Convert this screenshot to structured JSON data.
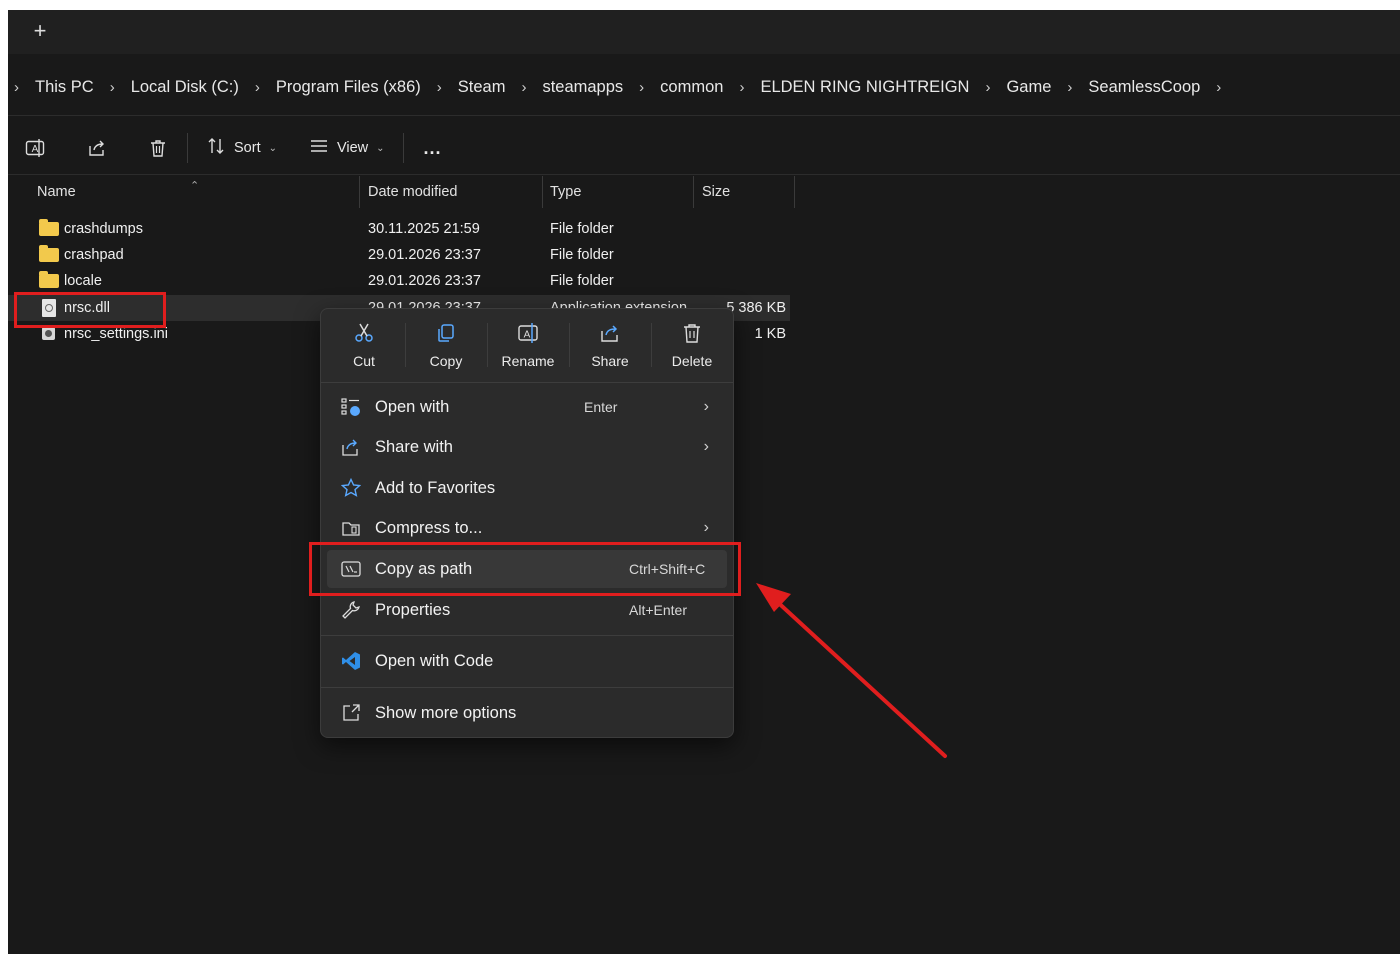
{
  "breadcrumb": [
    "This PC",
    "Local Disk (C:)",
    "Program Files (x86)",
    "Steam",
    "steamapps",
    "common",
    "ELDEN RING NIGHTREIGN",
    "Game",
    "SeamlessCoop"
  ],
  "new_tab_symbol": "+",
  "toolbar": {
    "sort_label": "Sort",
    "view_label": "View",
    "more_label": "..."
  },
  "columns": {
    "name": "Name",
    "date": "Date modified",
    "type": "Type",
    "size": "Size"
  },
  "files": [
    {
      "name": "crashdumps",
      "date": "30.11.2025 21:59",
      "type": "File folder",
      "size": "",
      "icon": "folder-icon"
    },
    {
      "name": "crashpad",
      "date": "29.01.2026 23:37",
      "type": "File folder",
      "size": "",
      "icon": "folder-icon"
    },
    {
      "name": "locale",
      "date": "29.01.2026 23:37",
      "type": "File folder",
      "size": "",
      "icon": "folder-icon"
    },
    {
      "name": "nrsc.dll",
      "date": "29.01.2026 23:37",
      "type": "Application extension",
      "size": "5 386 KB",
      "icon": "dll-file-icon"
    },
    {
      "name": "nrsc_settings.ini",
      "date": "",
      "type": "",
      "size": "1 KB",
      "icon": "ini-file-icon"
    }
  ],
  "context_menu": {
    "quick_actions": [
      "Cut",
      "Copy",
      "Rename",
      "Share",
      "Delete"
    ],
    "items": [
      {
        "label": "Open with",
        "shortcut": "Enter",
        "submenu": true,
        "icon": "open-with-icon"
      },
      {
        "label": "Share with",
        "shortcut": "",
        "submenu": true,
        "icon": "share-icon"
      },
      {
        "label": "Add to Favorites",
        "shortcut": "",
        "submenu": false,
        "icon": "star-icon"
      },
      {
        "label": "Compress to...",
        "shortcut": "",
        "submenu": true,
        "icon": "archive-icon"
      },
      {
        "label": "Copy as path",
        "shortcut": "Ctrl+Shift+C",
        "submenu": false,
        "icon": "copy-path-icon"
      },
      {
        "label": "Properties",
        "shortcut": "Alt+Enter",
        "submenu": false,
        "icon": "wrench-icon"
      },
      {
        "label": "Open with Code",
        "shortcut": "",
        "submenu": false,
        "icon": "vscode-icon"
      },
      {
        "label": "Show more options",
        "shortcut": "",
        "submenu": false,
        "icon": "more-options-icon"
      }
    ]
  },
  "colors": {
    "highlight": "#e01e1e",
    "window_bg": "#191919",
    "menu_bg": "#2b2b2b",
    "folder": "#f2c94c"
  }
}
